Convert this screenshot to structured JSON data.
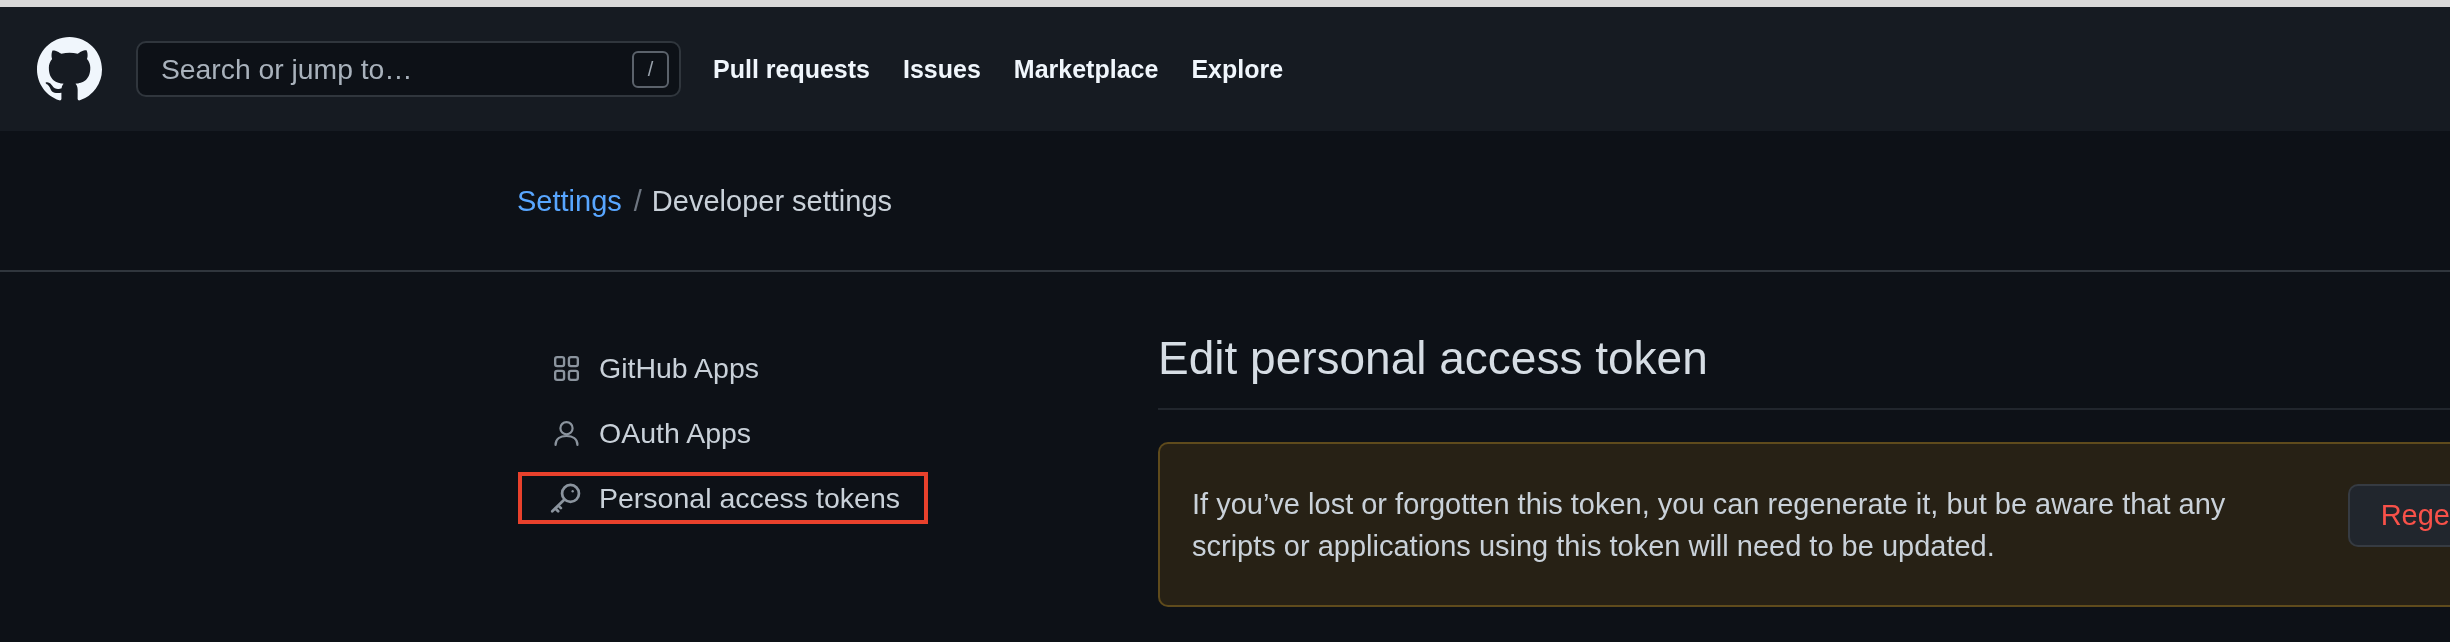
{
  "header": {
    "search": {
      "placeholder": "Search or jump to…",
      "shortcut": "/"
    },
    "nav": [
      "Pull requests",
      "Issues",
      "Marketplace",
      "Explore"
    ]
  },
  "breadcrumb": {
    "parent": "Settings",
    "separator": "/",
    "current": "Developer settings"
  },
  "sidebar": {
    "items": [
      {
        "label": "GitHub Apps",
        "highlighted": false
      },
      {
        "label": "OAuth Apps",
        "highlighted": false
      },
      {
        "label": "Personal access tokens",
        "highlighted": true
      }
    ]
  },
  "main": {
    "title": "Edit personal access token",
    "notice": {
      "text": "If you’ve lost or forgotten this token, you can regenerate it, but be aware that any scripts or applications using this token will need to be updated.",
      "button": "Rege"
    }
  }
}
